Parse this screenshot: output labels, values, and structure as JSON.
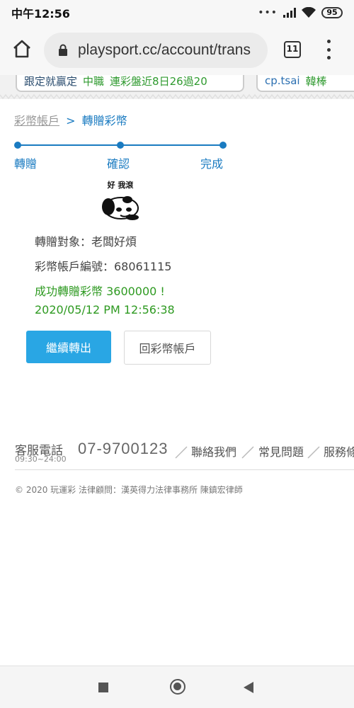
{
  "status_bar": {
    "time": "中午12:56",
    "battery": "95",
    "icons": [
      "dots-icon",
      "signal-icon",
      "wifi-icon",
      "battery-icon"
    ]
  },
  "browser": {
    "url": "playsport.cc/account/trans",
    "tab_count": "11",
    "icons": [
      "home-icon",
      "lock-icon",
      "menu-icon"
    ]
  },
  "banner": {
    "left": {
      "label": "跟定就贏定",
      "league": "中職",
      "streak": "連彩盤近8日26過20"
    },
    "right": {
      "user": "cp.tsai",
      "pick": "韓棒"
    }
  },
  "breadcrumb": {
    "link": "彩幣帳戶",
    "separator": ">",
    "current": "轉贈彩幣"
  },
  "stepper": {
    "steps": [
      "轉贈",
      "確認",
      "完成"
    ]
  },
  "sticker": {
    "caption": "好 我滾",
    "icon": "panda-meme-icon"
  },
  "result": {
    "recipient": "轉贈對象：老闆好煩",
    "account": "彩幣帳戶編號：68061115",
    "success": "成功轉贈彩幣 3600000 !",
    "timestamp": "2020/05/12 PM 12:56:38"
  },
  "actions": {
    "continue": "繼續轉出",
    "back": "回彩幣帳戶"
  },
  "footer": {
    "cs_label": "客服電話",
    "cs_hours": "09:30~24:00",
    "phone": "07-9700123",
    "links": [
      "聯絡我們",
      "常見問題",
      "服務條"
    ],
    "copyright": "© 2020 玩運彩 法律顧問：漢英得力法律事務所 陳鎮宏律師"
  },
  "colors": {
    "accent": "#1a7bc1",
    "primary_button": "#29a6e4",
    "success": "#2e9a21"
  }
}
